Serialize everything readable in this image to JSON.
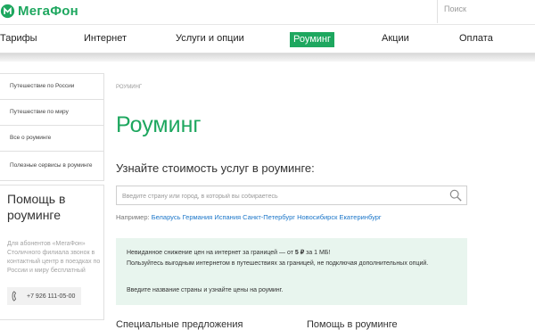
{
  "header": {
    "brand": "МегаФон",
    "search_label": "Поиск"
  },
  "nav": {
    "items": [
      {
        "label": "Тарифы"
      },
      {
        "label": "Интернет"
      },
      {
        "label": "Услуги и опции"
      },
      {
        "label": "Роуминг",
        "active": true
      },
      {
        "label": "Акции"
      },
      {
        "label": "Оплата"
      }
    ]
  },
  "sidebar": {
    "menu": [
      {
        "label": "Путешествие по России"
      },
      {
        "label": "Путешествие по миру"
      },
      {
        "label": "Все о роуминге"
      },
      {
        "label": "Полезные сервисы в роуминге"
      }
    ],
    "help": {
      "title": "Помощь в роуминге",
      "text": "Для абонентов «МегаФон» Столичного филиала звонок в контактный центр в поездках по России и миру бесплатный",
      "phone": "+7 926 111-05-00"
    }
  },
  "main": {
    "breadcrumb": "Роуминг",
    "title": "Роуминг",
    "section_title": "Узнайте стоимость услуг в роуминге:",
    "search_placeholder": "Введите страну или город, в который вы собираетесь",
    "examples_label": "Например:",
    "examples": [
      "Беларусь",
      "Германия",
      "Испания",
      "Санкт-Петербург",
      "Новосибирск",
      "Екатеринбург"
    ],
    "info": {
      "line1_prefix": "Невиданное снижение цен на интернет за границей — от",
      "line1_price": "5 ₽",
      "line1_suffix": "за 1 МБ!",
      "line2": "Пользуйтесь выгодным интернетом в путешествиях за границей, не подключая дополнительных опций.",
      "line3": "Введите название страны и узнайте цены на роуминг."
    },
    "bottom_left": "Специальные предложения",
    "bottom_right": "Помощь в роуминге"
  },
  "colors": {
    "brand_green": "#1ea75f",
    "link_blue": "#1b76c9",
    "info_bg": "#e8f5ee"
  },
  "icons": {
    "logo": "megafon-logo-icon",
    "search": "magnifier-icon",
    "phone": "phone-icon"
  }
}
